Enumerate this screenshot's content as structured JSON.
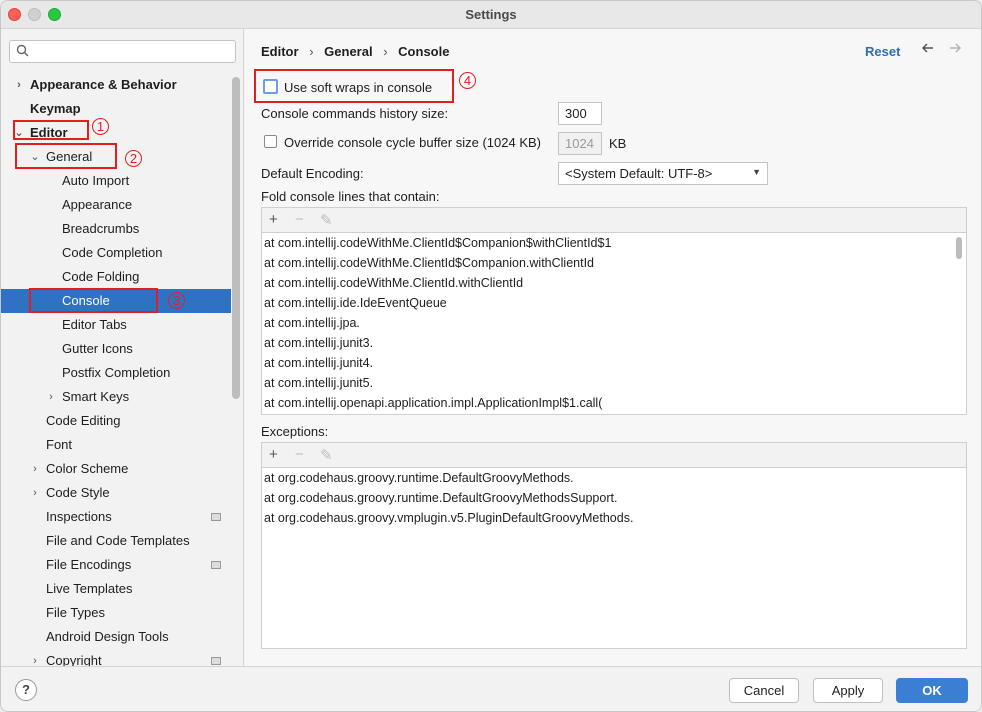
{
  "window": {
    "title": "Settings"
  },
  "sidebar": {
    "search_placeholder": "",
    "items": [
      {
        "label": "Appearance & Behavior",
        "level": 0,
        "bold": true,
        "arrow": "›"
      },
      {
        "label": "Keymap",
        "level": 0,
        "bold": true,
        "arrow": ""
      },
      {
        "label": "Editor",
        "level": 0,
        "bold": true,
        "arrow": "⌄"
      },
      {
        "label": "General",
        "level": 1,
        "bold": false,
        "arrow": "⌄"
      },
      {
        "label": "Auto Import",
        "level": 2,
        "bold": false,
        "arrow": ""
      },
      {
        "label": "Appearance",
        "level": 2,
        "bold": false,
        "arrow": ""
      },
      {
        "label": "Breadcrumbs",
        "level": 2,
        "bold": false,
        "arrow": ""
      },
      {
        "label": "Code Completion",
        "level": 2,
        "bold": false,
        "arrow": ""
      },
      {
        "label": "Code Folding",
        "level": 2,
        "bold": false,
        "arrow": ""
      },
      {
        "label": "Console",
        "level": 2,
        "bold": false,
        "arrow": "",
        "selected": true
      },
      {
        "label": "Editor Tabs",
        "level": 2,
        "bold": false,
        "arrow": ""
      },
      {
        "label": "Gutter Icons",
        "level": 2,
        "bold": false,
        "arrow": ""
      },
      {
        "label": "Postfix Completion",
        "level": 2,
        "bold": false,
        "arrow": ""
      },
      {
        "label": "Smart Keys",
        "level": 2,
        "bold": false,
        "arrow": "›"
      },
      {
        "label": "Code Editing",
        "level": 1,
        "bold": false,
        "arrow": ""
      },
      {
        "label": "Font",
        "level": 1,
        "bold": false,
        "arrow": ""
      },
      {
        "label": "Color Scheme",
        "level": 1,
        "bold": false,
        "arrow": "›"
      },
      {
        "label": "Code Style",
        "level": 1,
        "bold": false,
        "arrow": "›"
      },
      {
        "label": "Inspections",
        "level": 1,
        "bold": false,
        "arrow": "",
        "badge": true
      },
      {
        "label": "File and Code Templates",
        "level": 1,
        "bold": false,
        "arrow": ""
      },
      {
        "label": "File Encodings",
        "level": 1,
        "bold": false,
        "arrow": "",
        "badge": true
      },
      {
        "label": "Live Templates",
        "level": 1,
        "bold": false,
        "arrow": ""
      },
      {
        "label": "File Types",
        "level": 1,
        "bold": false,
        "arrow": ""
      },
      {
        "label": "Android Design Tools",
        "level": 1,
        "bold": false,
        "arrow": ""
      },
      {
        "label": "Copyright",
        "level": 1,
        "bold": false,
        "arrow": "›",
        "badge": true
      }
    ]
  },
  "breadcrumb": {
    "p1": "Editor",
    "sep": "›",
    "p2": "General",
    "p3": "Console"
  },
  "header": {
    "reset": "Reset",
    "back_icon": "arrow-left-icon",
    "forward_icon": "arrow-right-icon"
  },
  "settings": {
    "soft_wraps_label": "Use soft wraps in console",
    "soft_wraps_checked": false,
    "history_label": "Console commands history size:",
    "history_value": "300",
    "override_label": "Override console cycle buffer size (1024 KB)",
    "override_checked": false,
    "buffer_value": "1024",
    "buffer_unit": "KB",
    "encoding_label": "Default Encoding:",
    "encoding_value": "<System Default: UTF-8>",
    "fold_label": "Fold console lines that contain:",
    "fold_lines": [
      "at com.intellij.codeWithMe.ClientId$Companion$withClientId$1",
      "at com.intellij.codeWithMe.ClientId$Companion.withClientId",
      "at com.intellij.codeWithMe.ClientId.withClientId",
      "at com.intellij.ide.IdeEventQueue",
      "at com.intellij.jpa.",
      "at com.intellij.junit3.",
      "at com.intellij.junit4.",
      "at com.intellij.junit5.",
      "at com.intellij.openapi.application.impl.ApplicationImpl$1.call("
    ],
    "exceptions_label": "Exceptions:",
    "exception_lines": [
      "at org.codehaus.groovy.runtime.DefaultGroovyMethods.",
      "at org.codehaus.groovy.runtime.DefaultGroovyMethodsSupport.",
      "at org.codehaus.groovy.vmplugin.v5.PluginDefaultGroovyMethods."
    ],
    "toolbar": {
      "add": "+",
      "remove": "−",
      "edit": "✎"
    }
  },
  "annotations": [
    "1",
    "2",
    "3",
    "4"
  ],
  "footer": {
    "help": "?",
    "cancel": "Cancel",
    "apply": "Apply",
    "ok": "OK"
  },
  "colors": {
    "selection": "#2f72c4",
    "accent": "#3b7fd4",
    "annotation": "#e02020"
  }
}
